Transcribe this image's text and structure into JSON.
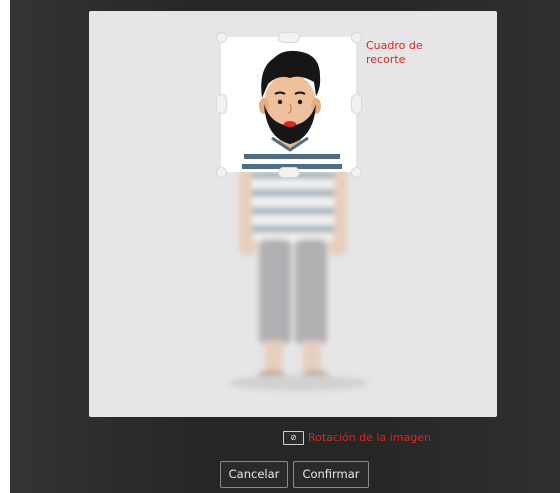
{
  "annotations": {
    "crop_box_label": "Cuadro de\nrecorte",
    "rotation_label": "Rotación de la imagen"
  },
  "toolbar": {
    "rotate_glyph": "⊘"
  },
  "actions": {
    "cancel_label": "Cancelar",
    "confirm_label": "Confirmar"
  },
  "colors": {
    "overlay": "#262626",
    "panel": "#e6e6e7",
    "annotation": "#d8271f",
    "button_border": "#8a8a8a"
  }
}
